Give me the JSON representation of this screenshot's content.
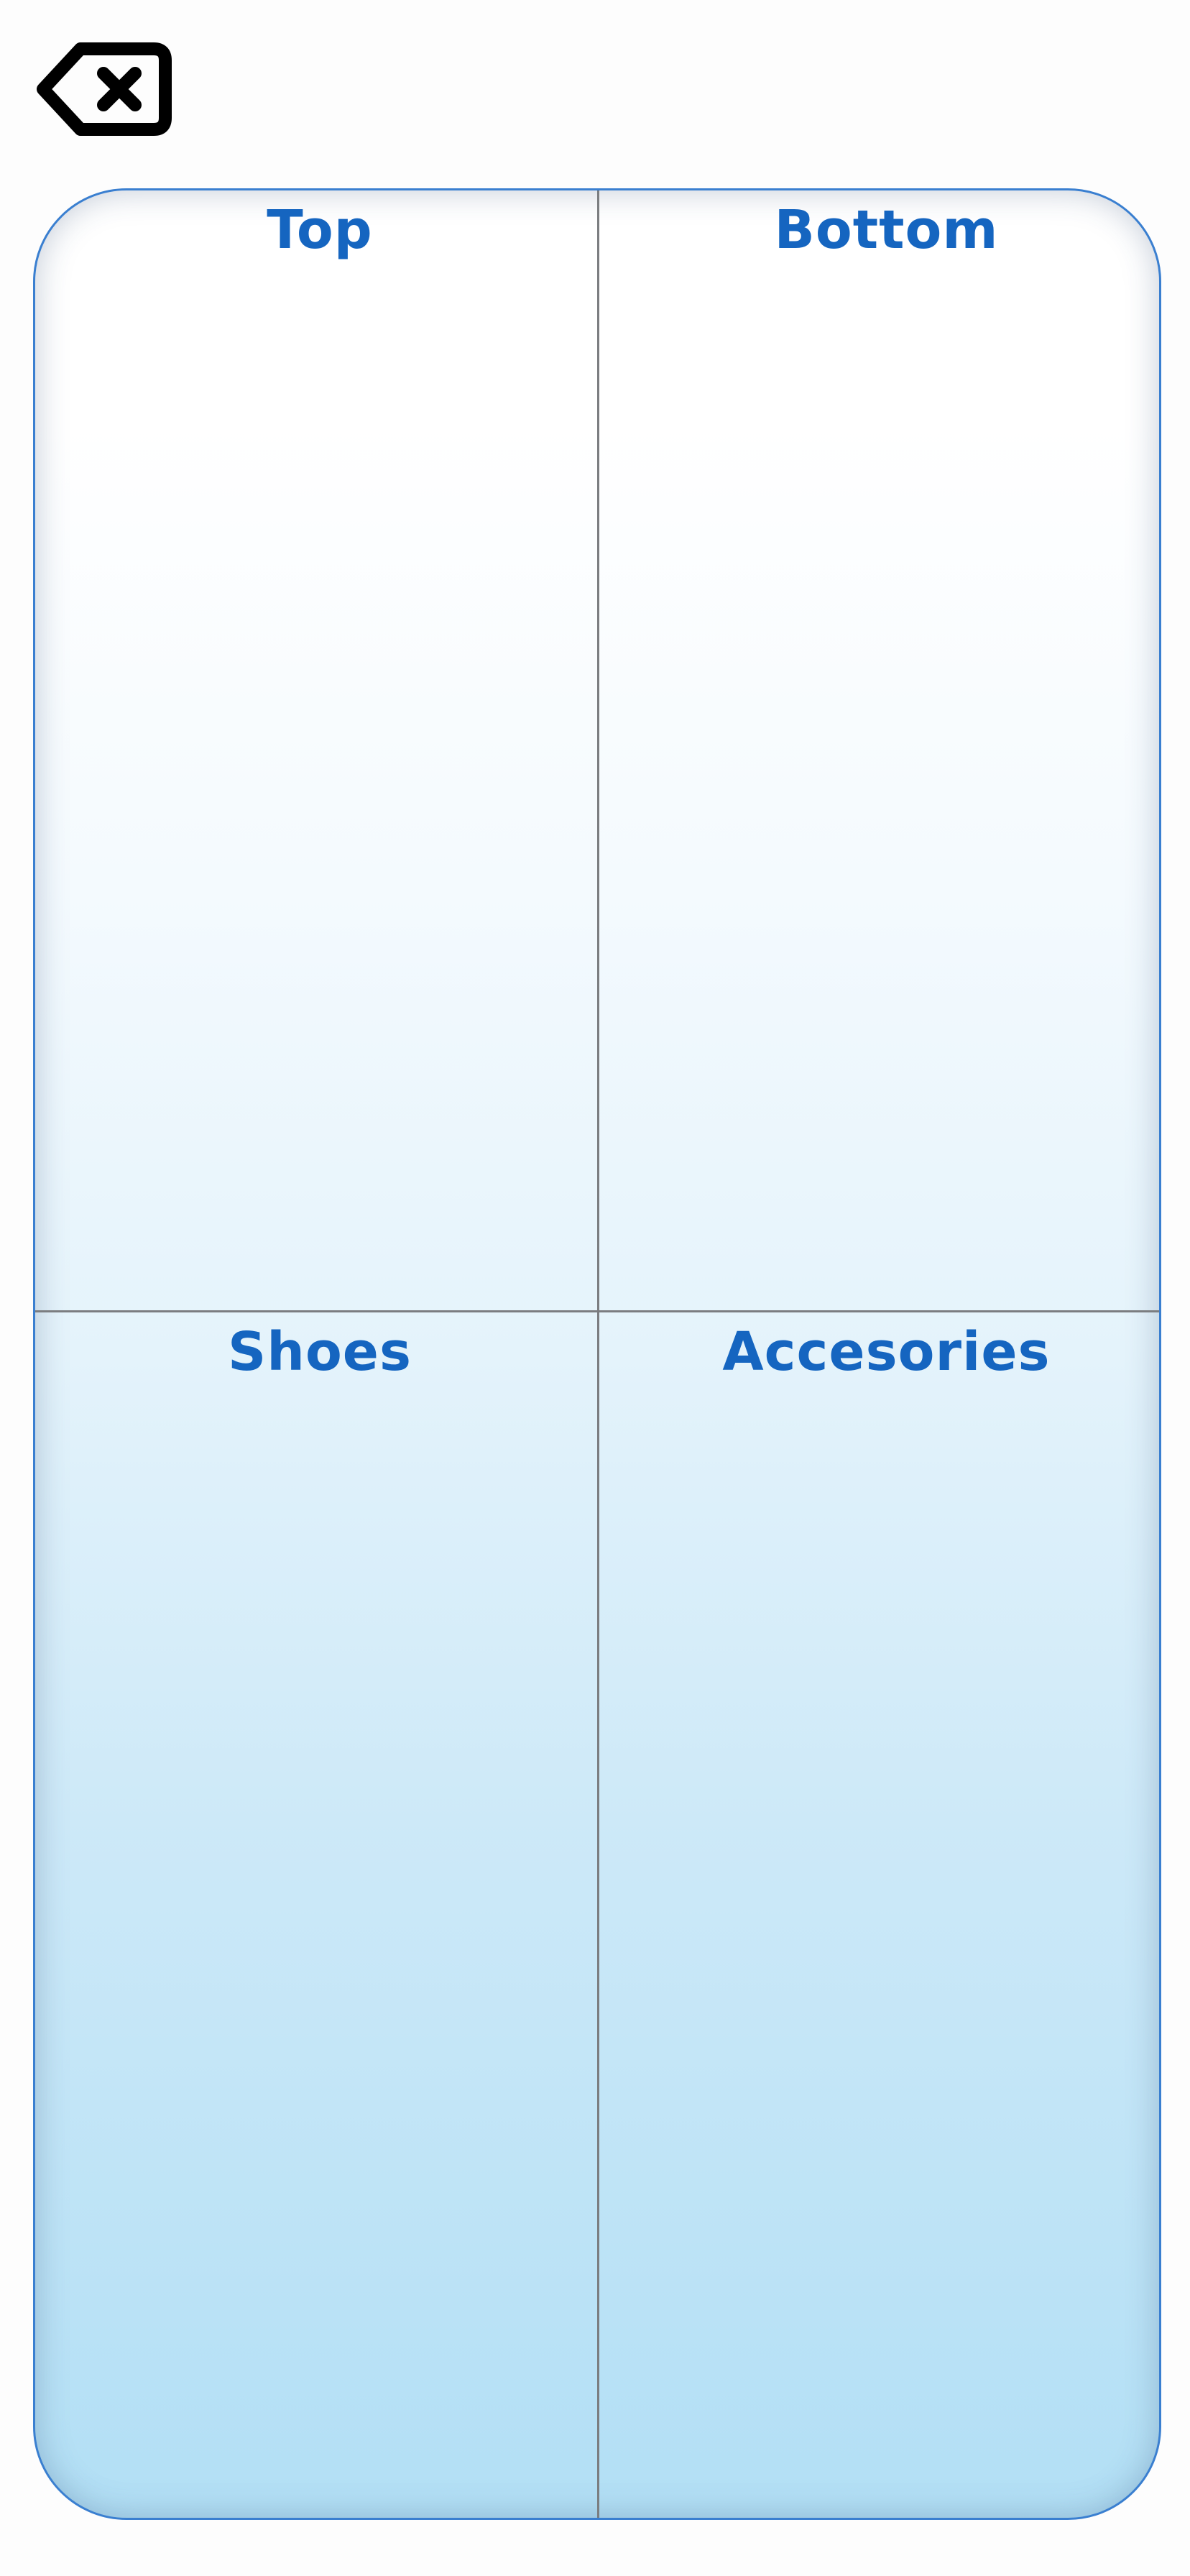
{
  "header": {
    "back_icon": "backspace-x-icon"
  },
  "board": {
    "border_color": "#3a7fd0",
    "label_color": "#1565c0",
    "categories": [
      {
        "label": "Top"
      },
      {
        "label": "Bottom"
      },
      {
        "label": "Shoes"
      },
      {
        "label": "Accesories"
      }
    ]
  }
}
